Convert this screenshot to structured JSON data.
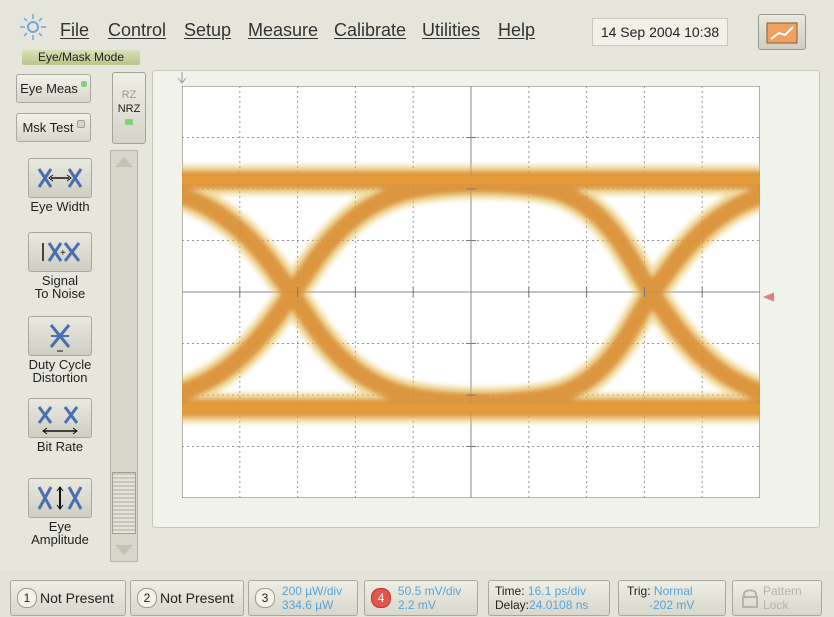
{
  "menu": {
    "items": [
      "File",
      "Control",
      "Setup",
      "Measure",
      "Calibrate",
      "Utilities",
      "Help"
    ],
    "datetime": "14 Sep 2004   10:38"
  },
  "sidebar": {
    "mode_label": "Eye/Mask Mode",
    "eye_meas": "Eye Meas",
    "msk_test": "Msk Test",
    "rz": "RZ",
    "nrz": "NRZ",
    "tools": [
      {
        "label": "Eye Width",
        "icon": "eye-width-icon"
      },
      {
        "label": "Signal\nTo Noise",
        "icon": "signal-to-noise-icon"
      },
      {
        "label": "Duty Cycle\nDistortion",
        "icon": "duty-cycle-icon"
      },
      {
        "label": "Bit Rate",
        "icon": "bit-rate-icon"
      },
      {
        "label": "Eye\nAmplitude",
        "icon": "eye-amplitude-icon"
      }
    ]
  },
  "status": {
    "ch1_num": "1",
    "ch1": "Not Present",
    "ch2_num": "2",
    "ch2": "Not Present",
    "ch3_num": "3",
    "ch3_line1": "200 µW/div",
    "ch3_line2": "334.6 µW",
    "ch4_num": "4",
    "ch4_line1": "50.5 mV/div",
    "ch4_line2": "2.2 mV",
    "time_label": "Time:",
    "time_value": "16.1 ps/div",
    "delay_label": "Delay:",
    "delay_value": "24.0108 ns",
    "trig_label": "Trig:",
    "trig_value": "Normal",
    "trig_level": "-202 mV",
    "pattern_lock": "Pattern\nLock"
  },
  "colors": {
    "led_green": "#7ed37a",
    "ch4_red": "#e2564b",
    "value_blue": "#59a3d6",
    "eye_core": "#e69a3a",
    "eye_mid": "#d98a2f",
    "eye_edge": "#e5c15a"
  }
}
